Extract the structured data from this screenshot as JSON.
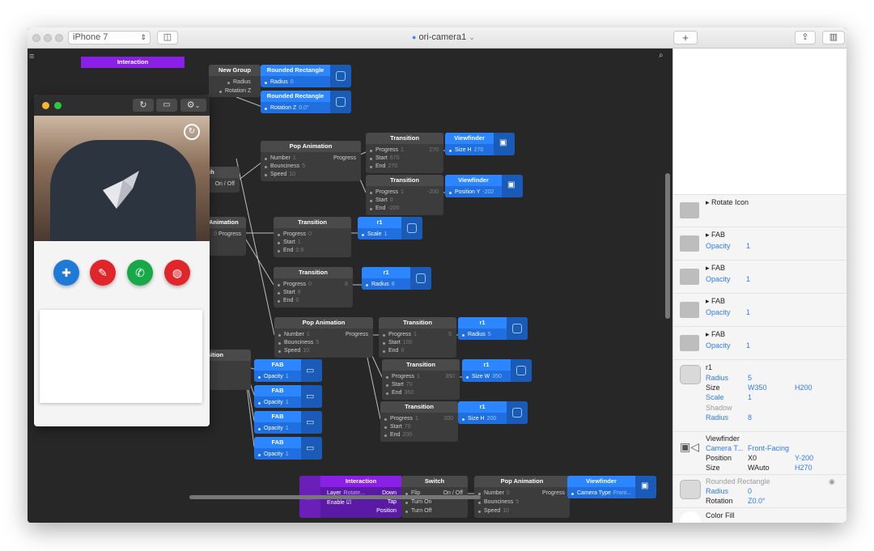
{
  "window": {
    "device": "iPhone 7",
    "document_title": "ori-camera1",
    "add_label": "+"
  },
  "canvas": {
    "menu_icon": "hamburger-icon",
    "search_icon": "search-icon"
  },
  "nodes": {
    "interaction_top": {
      "title": "Interaction"
    },
    "new_group": {
      "title": "New Group",
      "radius": "Radius",
      "rotation": "Rotation Z"
    },
    "rr1": {
      "title": "Rounded Rectangle",
      "prop": "Radius",
      "val": "0"
    },
    "rr2": {
      "title": "Rounded Rectangle",
      "prop": "Rotation Z",
      "val": "0.0°"
    },
    "switch_mid": {
      "title": "ch",
      "prop": "On / Off"
    },
    "pop1": {
      "title": "Pop Animation",
      "number": "Number",
      "number_v": "1",
      "bounciness": "Bounciness",
      "bounciness_v": "5",
      "speed": "Speed",
      "speed_v": "10",
      "out": "Progress"
    },
    "t1": {
      "title": "Transition",
      "progress": "Progress",
      "progress_v": "1",
      "out_v": "270",
      "start": "Start",
      "start_v": "670",
      "end": "End",
      "end_v": "270"
    },
    "vf1": {
      "title": "Viewfinder",
      "prop": "Size H",
      "val": "270"
    },
    "t2": {
      "title": "Transition",
      "progress": "Progress",
      "progress_v": "1",
      "out_v": "-200",
      "start": "Start",
      "start_v": "0",
      "end": "End",
      "end_v": "-200"
    },
    "vf2": {
      "title": "Viewfinder",
      "prop": "Position Y",
      "val": "-202"
    },
    "anim_mid": {
      "title": "Animation",
      "out": "Progress",
      "out_v": "0"
    },
    "t3": {
      "title": "Transition",
      "progress": "Progress",
      "progress_v": "0",
      "start": "Start",
      "start_v": "1",
      "end": "End",
      "end_v": "0.9"
    },
    "r1a": {
      "title": "r1",
      "prop": "Scale",
      "val": "1"
    },
    "t4": {
      "title": "Transition",
      "progress": "Progress",
      "progress_v": "0",
      "out_v": "8",
      "start": "Start",
      "start_v": "8",
      "end": "End",
      "end_v": "0"
    },
    "r1b": {
      "title": "r1",
      "prop": "Radius",
      "val": "8"
    },
    "pop2": {
      "title": "Pop Animation",
      "number": "Number",
      "number_v": "1",
      "bounciness": "Bounciness",
      "bounciness_v": "5",
      "speed": "Speed",
      "speed_v": "10",
      "out": "Progress"
    },
    "t5": {
      "title": "Transition",
      "progress": "Progress",
      "progress_v": "1",
      "out_v": "5",
      "start": "Start",
      "start_v": "100",
      "end": "End",
      "end_v": "0"
    },
    "r1c": {
      "title": "r1",
      "prop": "Radius",
      "val": "5"
    },
    "t6": {
      "title": "Transition",
      "progress": "Progress",
      "progress_v": "1",
      "out_v": "350",
      "start": "Start",
      "start_v": "70",
      "end": "End",
      "end_v": "350"
    },
    "r1d": {
      "title": "r1",
      "prop": "Size W",
      "val": "350"
    },
    "t7": {
      "title": "Transition",
      "progress": "Progress",
      "progress_v": "1",
      "out_v": "200",
      "start": "Start",
      "start_v": "70",
      "end": "End",
      "end_v": "200"
    },
    "r1e": {
      "title": "r1",
      "prop": "Size H",
      "val": "200"
    },
    "sition": {
      "title": "sition"
    },
    "fab_nodes": [
      {
        "title": "FAB",
        "prop": "Opacity",
        "val": "1"
      },
      {
        "title": "FAB",
        "prop": "Opacity",
        "val": "1"
      },
      {
        "title": "FAB",
        "prop": "Opacity",
        "val": "1"
      },
      {
        "title": "FAB",
        "prop": "Opacity",
        "val": "1"
      }
    ],
    "interaction_bottom": {
      "title": "Interaction",
      "layer": "Layer",
      "layer_v": "Rotate...",
      "enable": "Enable",
      "down": "Down",
      "tap": "Tap",
      "position": "Position"
    },
    "switch_bottom": {
      "title": "Switch",
      "flip": "Flip",
      "turn_on": "Turn On",
      "turn_off": "Turn Off",
      "out": "On / Off"
    },
    "pop3": {
      "title": "Pop Animation",
      "number": "Number",
      "number_v": "0",
      "bounciness": "Bounciness",
      "bounciness_v": "5",
      "speed": "Speed",
      "speed_v": "10",
      "out": "Progress"
    },
    "vf3": {
      "title": "Viewfinder",
      "prop": "Camera Type",
      "val": "Front..."
    }
  },
  "layers": {
    "rotate_icon": "▸ Rotate Icon",
    "fabs": [
      {
        "name": "▸ FAB",
        "prop": "Opacity",
        "val": "1"
      },
      {
        "name": "▸ FAB",
        "prop": "Opacity",
        "val": "1"
      },
      {
        "name": "▸ FAB",
        "prop": "Opacity",
        "val": "1"
      },
      {
        "name": "▸ FAB",
        "prop": "Opacity",
        "val": "1"
      }
    ],
    "r1": {
      "name": "r1",
      "radius_l": "Radius",
      "radius_v": "5",
      "size_l": "Size",
      "size_w": "W350",
      "size_h": "H200",
      "scale_l": "Scale",
      "scale_v": "1",
      "shadow_l": "Shadow",
      "shadow_radius_l": "Radius",
      "shadow_radius_v": "8"
    },
    "viewfinder": {
      "name": "Viewfinder",
      "cam_l": "Camera T...",
      "cam_v": "Front-Facing",
      "pos_l": "Position",
      "pos_x": "X0",
      "pos_y": "Y-200",
      "size_l": "Size",
      "size_w": "WAuto",
      "size_h": "H270"
    },
    "rounded": {
      "name": "Rounded Rectangle",
      "radius_l": "Radius",
      "radius_v": "0",
      "rot_l": "Rotation",
      "rot_v": "Z0.0°"
    },
    "color_fill": "Color Fill"
  },
  "colors": {
    "fab_blue": "#1e7ad6",
    "fab_red": "#e0262b",
    "fab_green": "#17a847",
    "node_blue": "#1f6fe0",
    "node_purple": "#8a1fe6"
  },
  "preview_icons": [
    "refresh-icon",
    "video-icon",
    "gear-icon",
    "switch-camera-icon"
  ],
  "fab_icons": [
    "add-person-icon",
    "pencil-icon",
    "phone-icon",
    "globe-icon"
  ]
}
